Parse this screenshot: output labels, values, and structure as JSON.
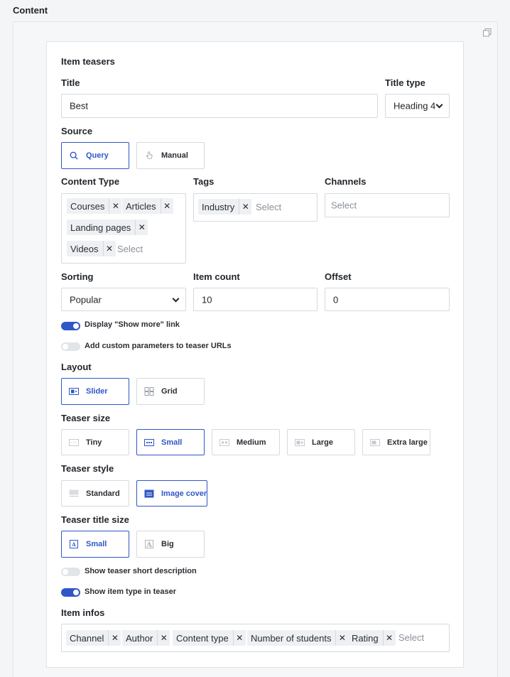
{
  "section_title": "Content",
  "panel": {
    "title": "Item teasers",
    "title_field": {
      "label": "Title",
      "value": "Best"
    },
    "title_type": {
      "label": "Title type",
      "value": "Heading 4"
    },
    "source": {
      "label": "Source",
      "options": [
        "Query",
        "Manual"
      ],
      "selected": "Query"
    },
    "content_type": {
      "label": "Content Type",
      "tags": [
        "Courses",
        "Articles",
        "Landing pages",
        "Videos"
      ],
      "placeholder": "Select"
    },
    "tags": {
      "label": "Tags",
      "tags": [
        "Industry"
      ],
      "placeholder": "Select"
    },
    "channels": {
      "label": "Channels",
      "placeholder": "Select"
    },
    "sorting": {
      "label": "Sorting",
      "value": "Popular"
    },
    "item_count": {
      "label": "Item count",
      "value": "10"
    },
    "offset": {
      "label": "Offset",
      "value": "0"
    },
    "toggles": [
      {
        "label": "Display \"Show more\" link",
        "on": true
      },
      {
        "label": "Add custom parameters to teaser URLs",
        "on": false
      }
    ],
    "layout": {
      "label": "Layout",
      "options": [
        "Slider",
        "Grid"
      ],
      "selected": "Slider"
    },
    "teaser_size": {
      "label": "Teaser size",
      "options": [
        "Tiny",
        "Small",
        "Medium",
        "Large",
        "Extra large"
      ],
      "selected": "Small"
    },
    "teaser_style": {
      "label": "Teaser style",
      "options": [
        "Standard",
        "Image cover"
      ],
      "selected": "Image cover"
    },
    "teaser_title_size": {
      "label": "Teaser title size",
      "options": [
        "Small",
        "Big"
      ],
      "selected": "Small"
    },
    "toggles2": [
      {
        "label": "Show teaser short description",
        "on": false
      },
      {
        "label": "Show item type in teaser",
        "on": true
      }
    ],
    "item_infos": {
      "label": "Item infos",
      "tags": [
        "Channel",
        "Author",
        "Content type",
        "Number of students",
        "Rating"
      ],
      "placeholder": "Select"
    }
  },
  "colors": {
    "accent": "#2f57c8",
    "border": "#d6d9de",
    "tag_bg": "#eef0f3"
  },
  "icons": {
    "query": "search-icon",
    "manual": "hand-pointer-icon",
    "slider": "slider-icon",
    "grid": "grid-icon",
    "copy": "copy-icon"
  }
}
